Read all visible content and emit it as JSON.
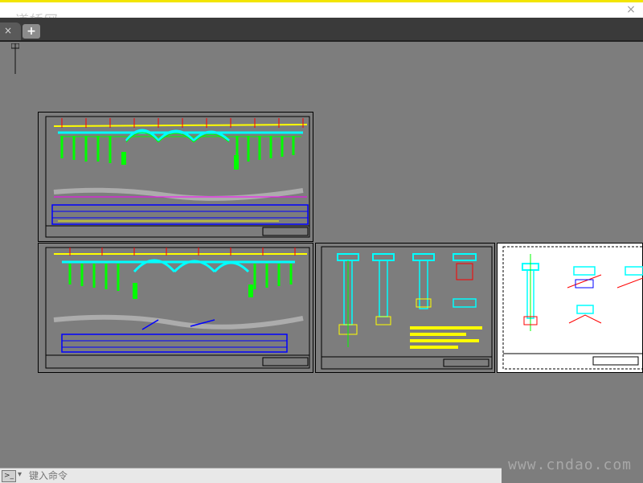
{
  "header": {
    "logo_text": "道桥网",
    "close_symbol": "×"
  },
  "tabs": {
    "close_symbol": "×",
    "new_tab_symbol": "+"
  },
  "command_line": {
    "icon_label": ">_",
    "placeholder": "键入命令"
  },
  "watermark": "www.cndao.com",
  "colors": {
    "model_background": "#7d7d7d",
    "sheet_border": "#000000",
    "header_highlight": "#f3e500",
    "cad_cyan": "#00ffff",
    "cad_green": "#00ff00",
    "cad_yellow": "#ffff00",
    "cad_red": "#ff0000",
    "cad_blue": "#0000ff",
    "cad_magenta": "#ff00ff"
  }
}
